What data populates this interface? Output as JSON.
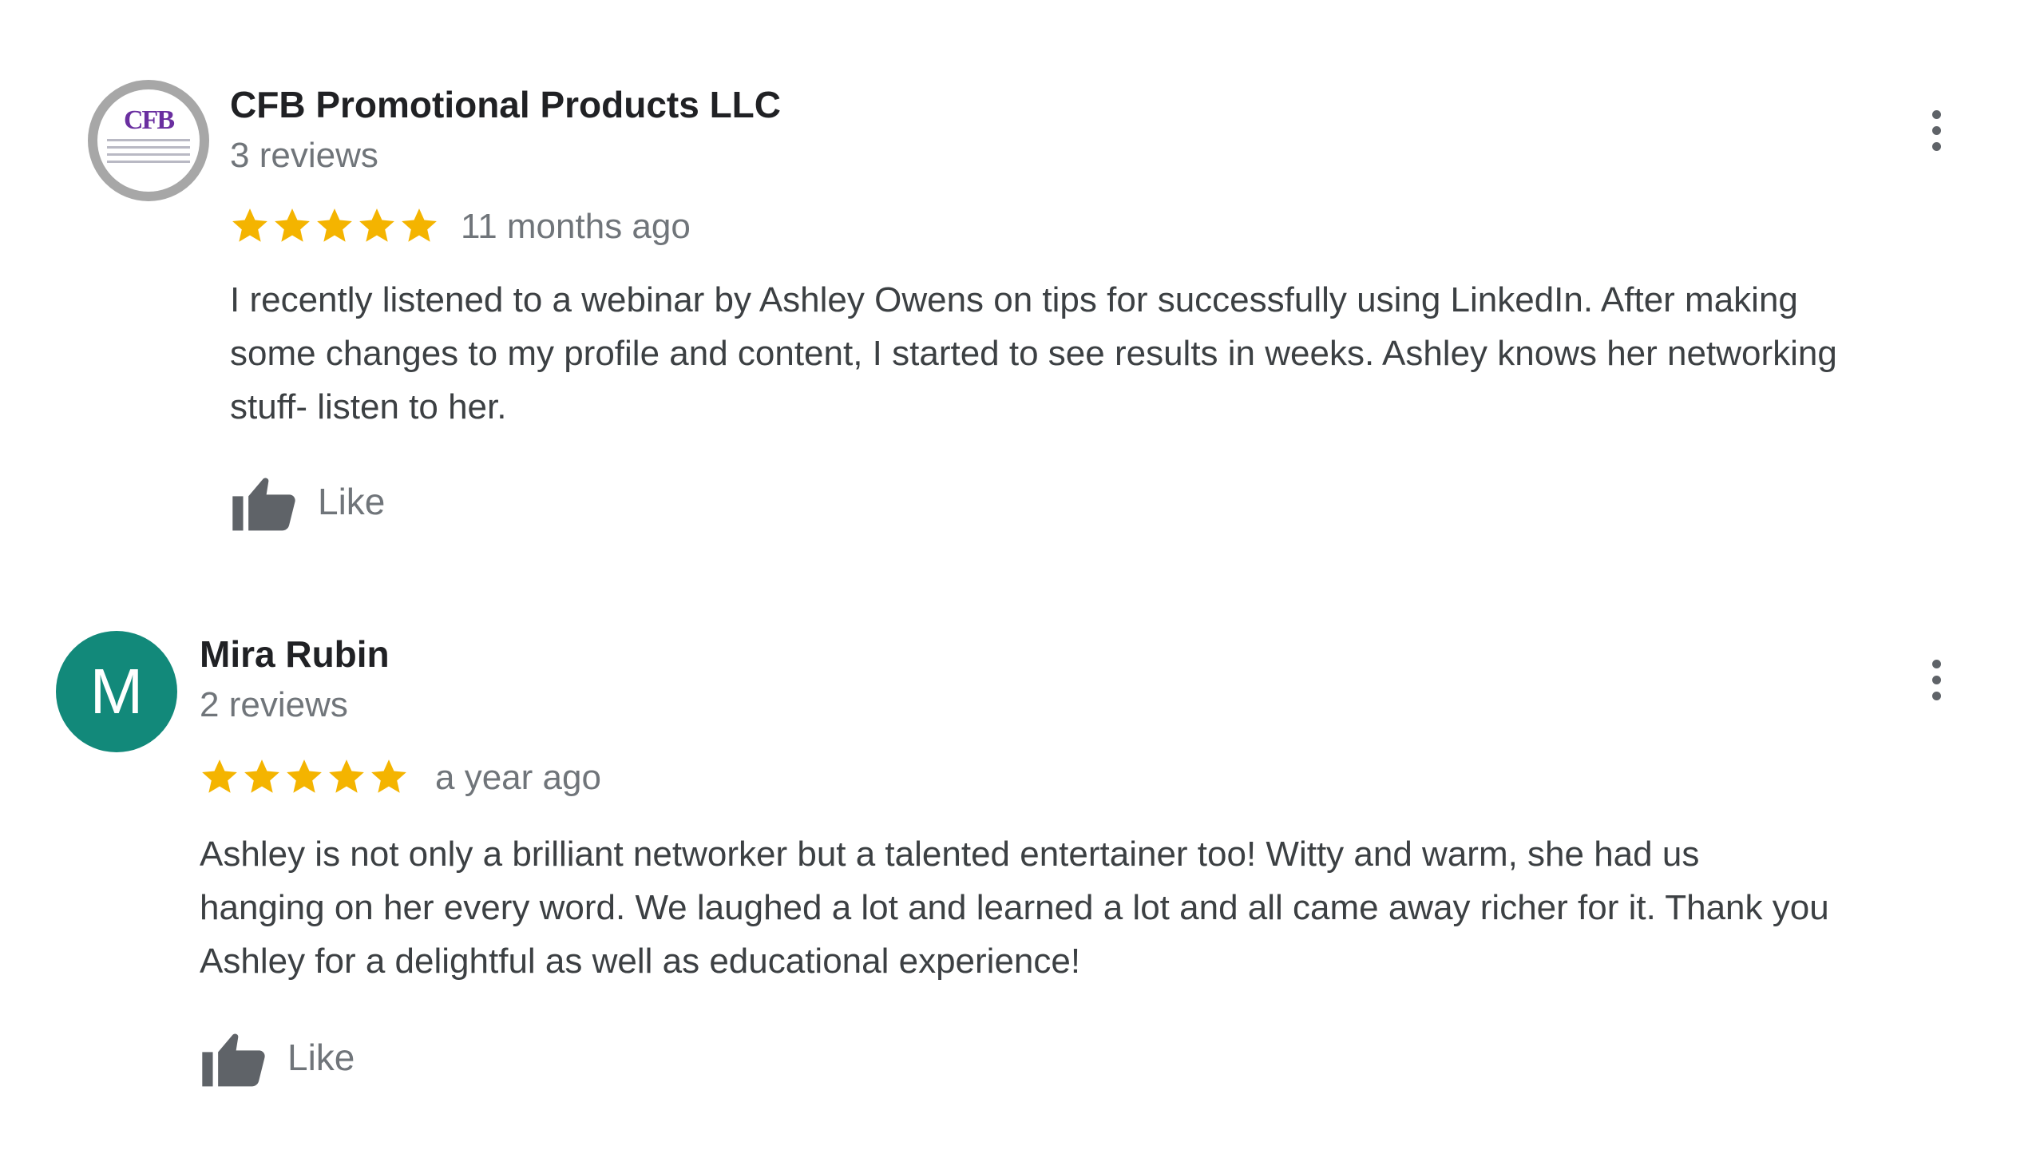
{
  "colors": {
    "star": "#f4b400",
    "avatar_teal": "#12897a",
    "name_text": "#202124",
    "meta_text": "#70757a",
    "body_text": "#3c4043"
  },
  "reviews": [
    {
      "reviewer_name": "CFB Promotional Products LLC",
      "avatar_type": "logo",
      "avatar_logo_text": "CFB",
      "review_count": "3 reviews",
      "rating": 5,
      "time_ago": "11 months ago",
      "text_lines": [
        "I recently listened to a webinar by Ashley Owens on tips for successfully using LinkedIn.  After making",
        "some changes to my profile and content, I started to see results in weeks.  Ashley knows her networking",
        "stuff- listen to her."
      ],
      "like_label": "Like",
      "like_icon": "thumbs-up-icon",
      "more_icon": "more-vertical-icon"
    },
    {
      "reviewer_name": "Mira Rubin",
      "avatar_type": "letter",
      "avatar_letter": "M",
      "review_count": "2 reviews",
      "rating": 5,
      "time_ago": "a year ago",
      "text_lines": [
        "Ashley is not only a brilliant networker but a talented entertainer too! Witty and warm, she had us",
        "hanging on her every word. We laughed a lot and learned a lot and all came away richer for it. Thank you",
        "Ashley for a delightful as well as educational experience!"
      ],
      "like_label": "Like",
      "like_icon": "thumbs-up-icon",
      "more_icon": "more-vertical-icon"
    }
  ]
}
